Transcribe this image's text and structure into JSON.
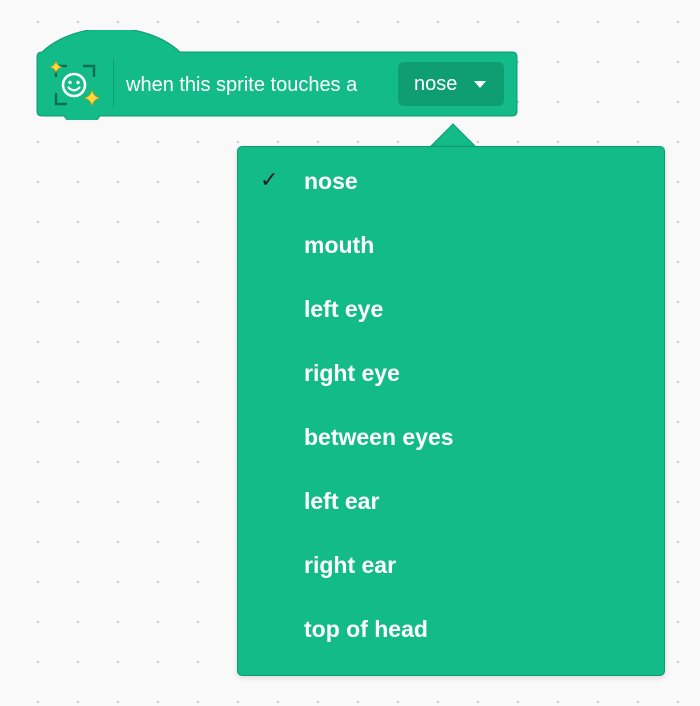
{
  "block": {
    "label": "when this sprite touches a",
    "icon": "face-sensing-icon",
    "selected_part": "nose",
    "color": "#13bb89",
    "dropdown_color": "#0f9d72"
  },
  "menu": {
    "selected_index": 0,
    "check_glyph": "✓",
    "items": [
      {
        "label": "nose"
      },
      {
        "label": "mouth"
      },
      {
        "label": "left eye"
      },
      {
        "label": "right eye"
      },
      {
        "label": "between eyes"
      },
      {
        "label": "left ear"
      },
      {
        "label": "right ear"
      },
      {
        "label": "top of head"
      }
    ]
  }
}
